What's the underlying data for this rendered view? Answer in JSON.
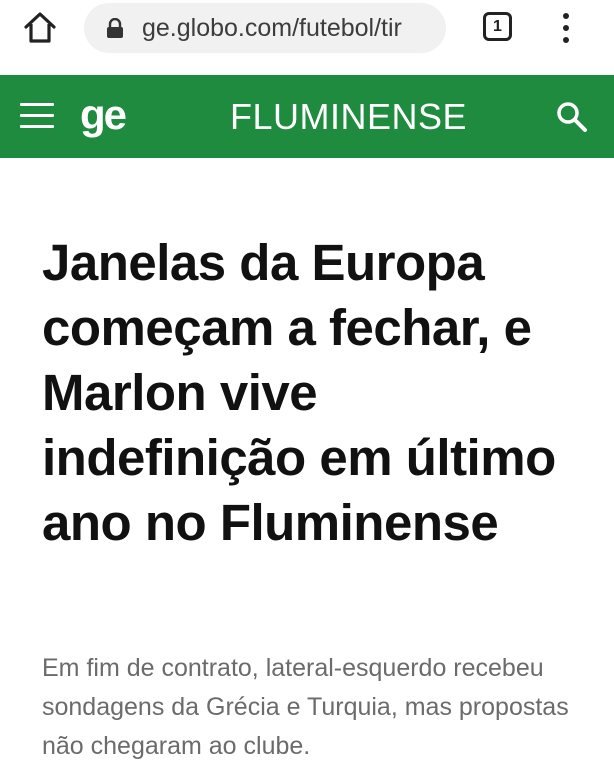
{
  "browser": {
    "url": "ge.globo.com/futebol/tir",
    "tab_count": "1"
  },
  "site_header": {
    "logo": "ge",
    "section": "FLUMINENSE",
    "brand_color": "#1f8b3e"
  },
  "article": {
    "headline": "Janelas da Europa começam a fechar, e Marlon vive indefinição em último ano no Fluminense",
    "subtitle": "Em fim de contrato, lateral-esquerdo recebeu sondagens da Grécia e Turquia, mas propostas não chegaram ao clube."
  }
}
